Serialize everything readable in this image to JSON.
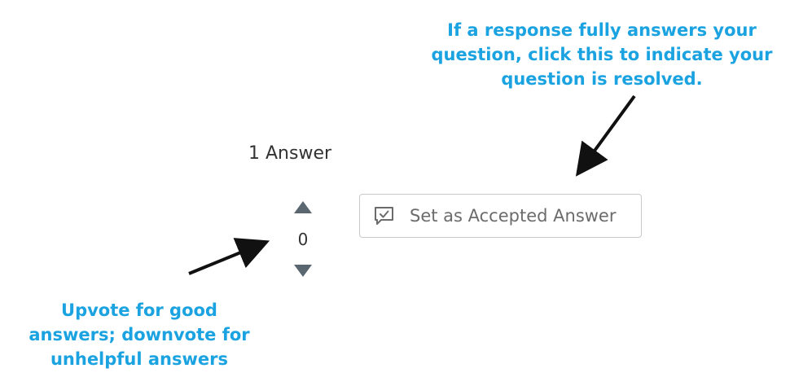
{
  "annotations": {
    "accept_tip": "If a response fully answers your\nquestion, click this to indicate your\nquestion is resolved.",
    "vote_tip": "Upvote for good\nanswers; downvote for\nunhelpful answers",
    "color": "#1aa3e0"
  },
  "answers": {
    "count_label": "1 Answer"
  },
  "vote": {
    "count": "0",
    "up_icon": "triangle-up-icon",
    "down_icon": "triangle-down-icon"
  },
  "accept_button": {
    "label": "Set as Accepted Answer",
    "icon": "chat-check-icon"
  }
}
